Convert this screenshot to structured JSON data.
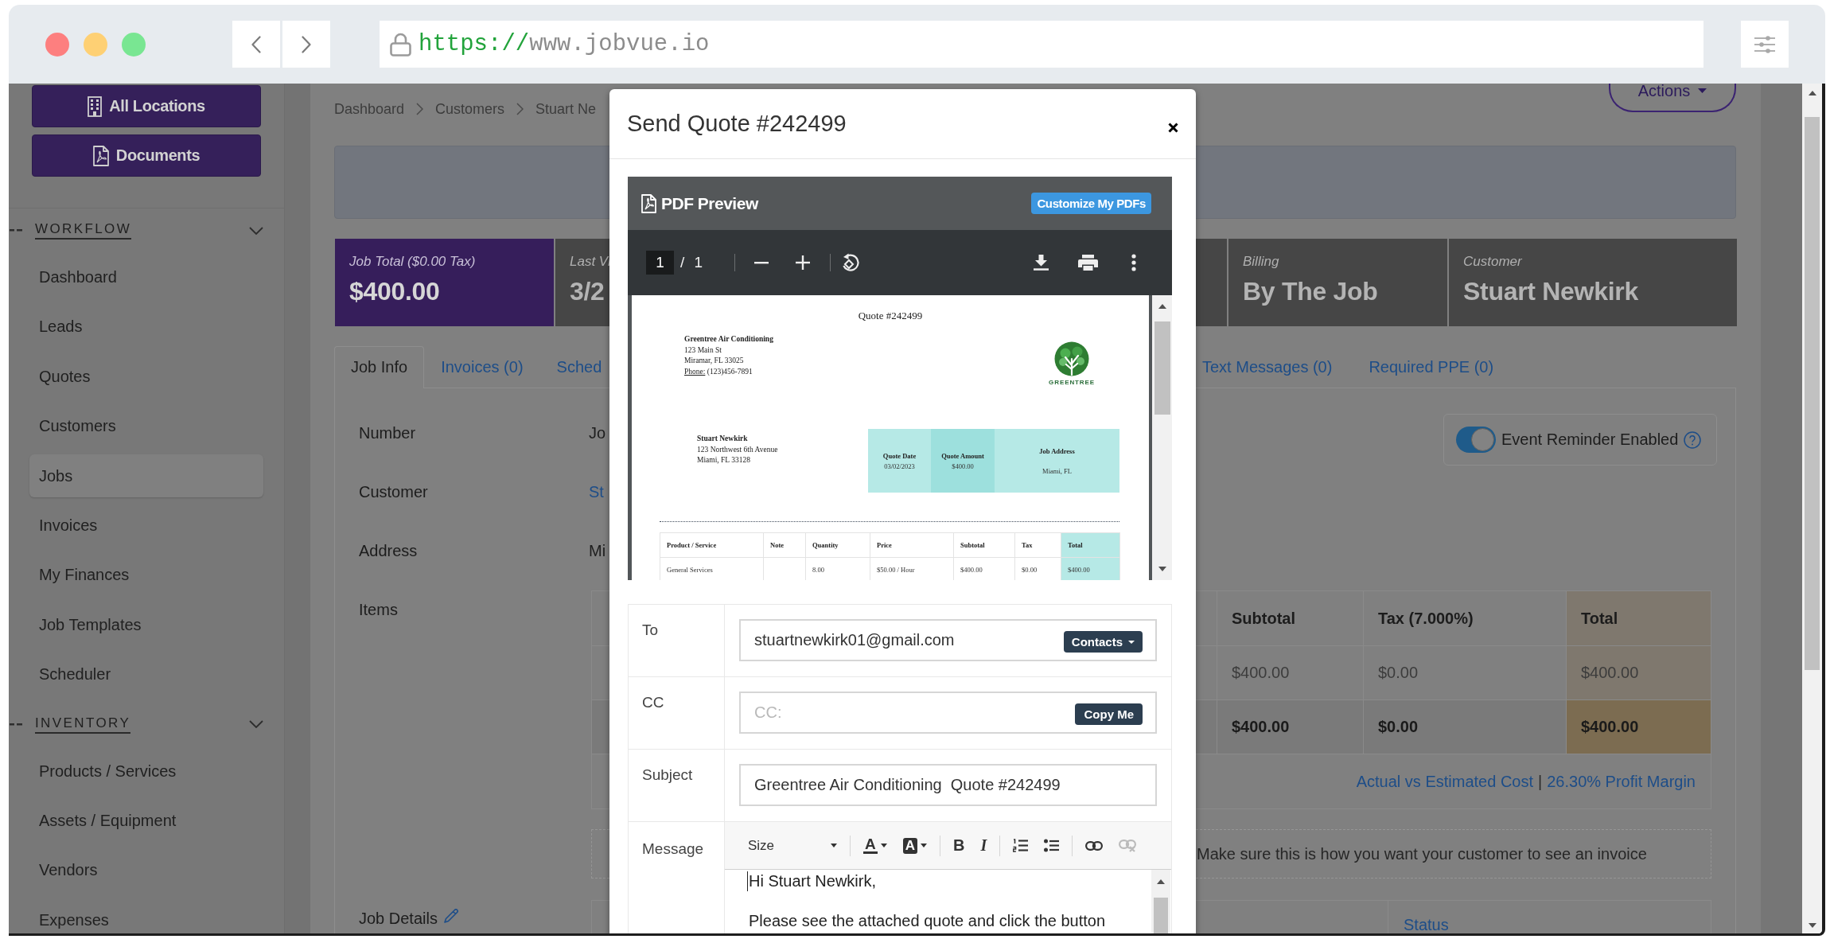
{
  "browser": {
    "url_scheme": "https://",
    "url_host": "www.jobvue.io"
  },
  "sidebar": {
    "buttons": [
      {
        "kind": "locations",
        "label": "All Locations"
      },
      {
        "kind": "documents",
        "label": "Documents"
      }
    ],
    "sections": [
      {
        "title": "WORKFLOW",
        "expanded": true,
        "items": [
          {
            "label": "Dashboard",
            "selected": false
          },
          {
            "label": "Leads",
            "selected": false
          },
          {
            "label": "Quotes",
            "selected": false
          },
          {
            "label": "Customers",
            "selected": false
          },
          {
            "label": "Jobs",
            "selected": true
          },
          {
            "label": "Invoices",
            "selected": false
          },
          {
            "label": "My Finances",
            "selected": false
          },
          {
            "label": "Job Templates",
            "selected": false
          },
          {
            "label": "Scheduler",
            "selected": false
          }
        ]
      },
      {
        "title": "INVENTORY",
        "expanded": true,
        "items": [
          {
            "label": "Products / Services",
            "selected": false
          },
          {
            "label": "Assets / Equipment",
            "selected": false
          },
          {
            "label": "Vendors",
            "selected": false
          },
          {
            "label": "Expenses",
            "selected": false
          }
        ]
      }
    ]
  },
  "page": {
    "breadcrumb": [
      "Dashboard",
      "Customers",
      "Stuart Ne"
    ],
    "actions_button": "Actions",
    "stat_cards": [
      {
        "kind": "highlight",
        "label": "Job Total ($0.00 Tax)",
        "value": "$400.00"
      },
      {
        "kind": "plain",
        "label": "Last Vi",
        "value": "3/2"
      },
      {
        "kind": "plain",
        "label": "Billing",
        "value": "By The Job"
      },
      {
        "kind": "plain",
        "label": "Customer",
        "value": "Stuart Newkirk"
      }
    ],
    "tabs": [
      {
        "label": "Job Info",
        "selected": true
      },
      {
        "label": "Invoices (0)",
        "selected": false
      },
      {
        "label": "Sched",
        "selected": false
      },
      {
        "label": "Text Messages (0)",
        "selected": false
      },
      {
        "label": "Required PPE (0)",
        "selected": false
      }
    ],
    "fields": [
      {
        "kind": "text",
        "label": "Number",
        "value": "Jo"
      },
      {
        "kind": "link",
        "label": "Customer",
        "value": "St"
      },
      {
        "kind": "text",
        "label": "Address",
        "value": "Mi"
      }
    ],
    "event_reminder": {
      "label": "Event Reminder Enabled",
      "on": true
    },
    "items": {
      "label": "Items",
      "columns": [
        "Subtotal",
        "Tax (7.000%)",
        "Total"
      ],
      "rows": [
        [
          "$400.00",
          "$0.00",
          "$400.00"
        ]
      ],
      "totals": [
        "$400.00",
        "$0.00",
        "$400.00"
      ],
      "cost_link": "Actual vs Estimated Cost",
      "separator": "|",
      "margin_link": "26.30% Profit Margin",
      "note": "Make sure this is how you want your customer to see an invoice"
    },
    "job_details": {
      "label": "Job Details",
      "columns": [
        "Status"
      ]
    }
  },
  "modal": {
    "title": "Send Quote #242499",
    "pdf": {
      "title": "PDF Preview",
      "customize_button": "Customize My PDFs",
      "page": "1",
      "page_count": "/ 1",
      "document": {
        "heading": "Quote #242499",
        "company_name": "Greentree Air Conditioning",
        "company_lines": [
          "123 Main St",
          "Miramar, FL 33025"
        ],
        "phone_label": "Phone:",
        "phone": "(123)456-7891",
        "logo_text": "GREENTREE",
        "customer_name": "Stuart Newkirk",
        "customer_lines": [
          "123 Northwest 6th Avenue",
          "Miami, FL 33128"
        ],
        "summary": [
          {
            "label": "Quote Date",
            "value": "03/02/2023",
            "highlight": false
          },
          {
            "label": "Quote Amount",
            "value": "$400.00",
            "highlight": true
          },
          {
            "label": "Job Address",
            "value": "Miami, FL",
            "highlight": false
          }
        ],
        "columns": [
          {
            "label": "Product / Service",
            "highlight": false
          },
          {
            "label": "Note",
            "highlight": false
          },
          {
            "label": "Quantity",
            "highlight": false
          },
          {
            "label": "Price",
            "highlight": false
          },
          {
            "label": "Subtotal",
            "highlight": false
          },
          {
            "label": "Tax",
            "highlight": false
          },
          {
            "label": "Total",
            "highlight": true
          }
        ],
        "rows": [
          [
            "General Services",
            null,
            "8.00",
            "$50.00 / Hour",
            "$400.00",
            "$0.00",
            "$400.00"
          ]
        ]
      }
    },
    "form": {
      "to": {
        "label": "To",
        "value": "stuartnewkirk01@gmail.com",
        "button": "Contacts"
      },
      "cc": {
        "label": "CC",
        "placeholder": "CC:",
        "button": "Copy Me"
      },
      "subject": {
        "label": "Subject",
        "value": "Greentree Air Conditioning  Quote #242499"
      },
      "message": {
        "label": "Message",
        "toolbar": [
          [
            {
              "kind": "size",
              "label": "Size",
              "disabled": false
            }
          ],
          [
            {
              "kind": "font-color",
              "label": "A",
              "disabled": false
            },
            {
              "kind": "highlight",
              "label": "A",
              "disabled": false
            }
          ],
          [
            {
              "kind": "bold",
              "label": "B",
              "disabled": false
            },
            {
              "kind": "italic",
              "label": "I",
              "disabled": false
            }
          ],
          [
            {
              "kind": "ordered-list",
              "disabled": false
            },
            {
              "kind": "bullet-list",
              "disabled": false
            }
          ],
          [
            {
              "kind": "link",
              "disabled": false
            },
            {
              "kind": "unlink",
              "disabled": true
            }
          ]
        ],
        "paragraphs": [
          "Hi Stuart Newkirk,",
          "Please see the attached quote and click the button"
        ]
      }
    }
  }
}
